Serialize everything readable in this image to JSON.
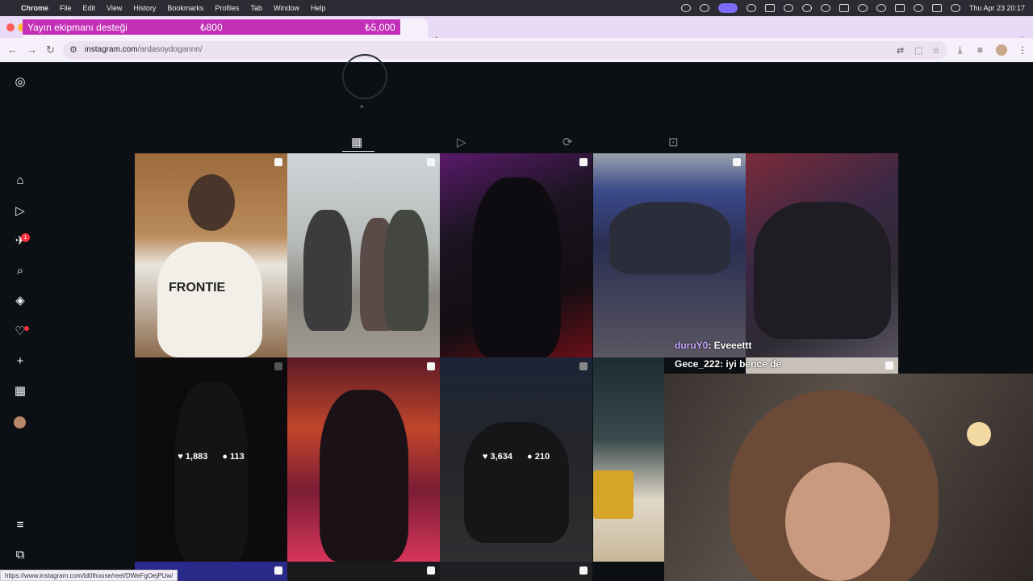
{
  "menubar": {
    "app_name": "Chrome",
    "menus": [
      "File",
      "Edit",
      "View",
      "History",
      "Bookmarks",
      "Profiles",
      "Tab",
      "Window",
      "Help"
    ],
    "datetime": "Thu Apr 23  20:17"
  },
  "browser": {
    "overlay_goal": {
      "label": "Yayın ekipmanı desteği",
      "current": "₺800",
      "target": "₺5,000"
    },
    "url_host": "instagram.com",
    "url_path": "/ardasoydogannn/",
    "status_url": "https://www.instagram.com/id0lhouse/reel/DWeFgOejPUw/"
  },
  "sidebar": {
    "notifications_badge": "1"
  },
  "grid": {
    "posts": [
      {
        "likes": "",
        "comments": ""
      },
      {
        "likes": "",
        "comments": ""
      },
      {
        "likes": "",
        "comments": ""
      },
      {
        "likes": "",
        "comments": ""
      },
      {
        "likes": "",
        "comments": ""
      },
      {
        "likes": "1,883",
        "comments": "113"
      },
      {
        "likes": "",
        "comments": ""
      },
      {
        "likes": "3,634",
        "comments": "210"
      }
    ],
    "print_text": "FRONTIE"
  },
  "chat": [
    {
      "user": "duruY0",
      "message": ": Eveeettt"
    },
    {
      "user": "Gece_222",
      "message": ": iyi bence de"
    }
  ],
  "colors": {
    "overlay_bar": "#c330b7",
    "background": "#0c1014",
    "badge": "#ff3040"
  }
}
